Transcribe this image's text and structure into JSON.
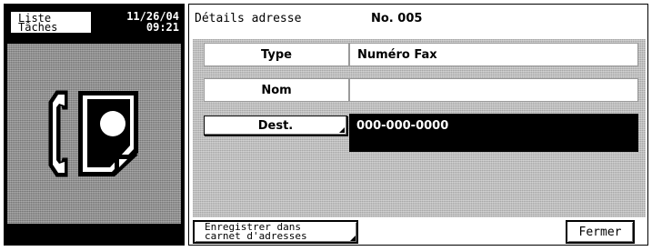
{
  "left_panel": {
    "job_list_button": "Liste\nTâches",
    "clock": {
      "date": "11/26/04",
      "time": "09:21"
    },
    "icon": "fax-icon"
  },
  "header": {
    "title": "Détails adresse",
    "number": "No. 005"
  },
  "rows": [
    {
      "label": "Type",
      "value": "Numéro Fax"
    },
    {
      "label": "Nom",
      "value": ""
    }
  ],
  "destination": {
    "button_label": "Dest.",
    "value": "000-000-0000"
  },
  "footer": {
    "save_button": "Enregistrer dans\ncarnet d'adresses",
    "close_button": "Fermer"
  },
  "colors": {
    "panel_dark": "#000000",
    "screen_bg": "#ffffff",
    "pattern_gray": "#bdbdbd"
  }
}
